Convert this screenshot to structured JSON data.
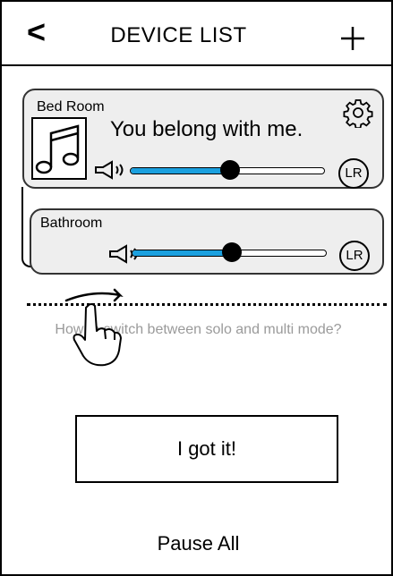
{
  "header": {
    "back_icon": "chevron-left-icon",
    "back_glyph": "<",
    "title": "DEVICE LIST",
    "add_icon": "plus-icon"
  },
  "devices": [
    {
      "room": "Bed Room",
      "now_playing": "You belong with me.",
      "artwork_icon": "music-note-icon",
      "settings_icon": "gear-icon",
      "volume_icon": "speaker-icon",
      "volume": 0.52,
      "channel_label": "LR"
    },
    {
      "room": "Bathroom",
      "volume_icon": "speaker-icon",
      "volume": 0.52,
      "channel_label": "LR"
    }
  ],
  "tutorial": {
    "hint": "How to switch between solo and multi mode?",
    "hand_icon": "pointing-hand-icon",
    "arrow_icon": "swipe-arrow-icon",
    "confirm_label": "I got it!"
  },
  "footer": {
    "pause_all_label": "Pause All"
  },
  "colors": {
    "accent": "#1aa0df",
    "card_background": "#eeeeee",
    "hint_text": "#9a9a9a"
  }
}
